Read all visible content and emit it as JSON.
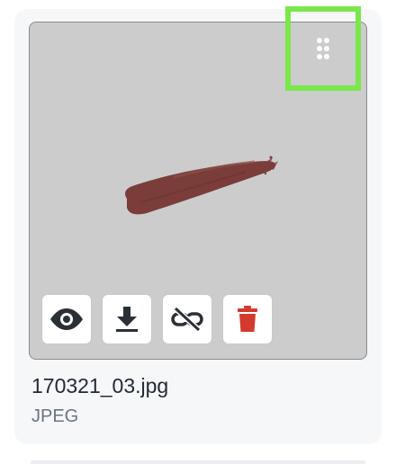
{
  "file": {
    "name": "170321_03.jpg",
    "type": "JPEG"
  },
  "icons": {
    "drag_handle": "drag-dots-icon",
    "preview": "eye-icon",
    "download": "download-icon",
    "unlink": "unlink-icon",
    "delete": "trash-icon"
  },
  "colors": {
    "card_background": "#f6f7f9",
    "thumbnail_background": "#cccccc",
    "drag_highlight": "#7ae84a",
    "delete_icon": "#d23a2e",
    "icon_dark": "#2b2f36",
    "stroke_color": "#7a3d3a"
  }
}
